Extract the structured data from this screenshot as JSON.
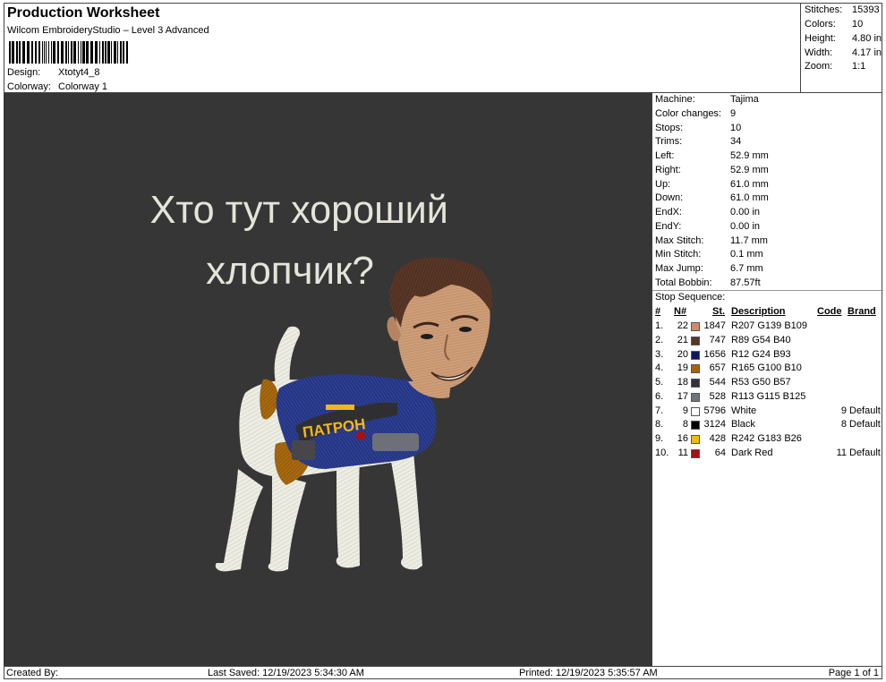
{
  "header": {
    "title": "Production Worksheet",
    "subtitle": "Wilcom EmbroideryStudio – Level 3 Advanced",
    "design_label": "Design:",
    "design_value": "Xtotyt4_8",
    "colorway_label": "Colorway:",
    "colorway_value": "Colorway 1"
  },
  "summary": {
    "stitches_label": "Stitches:",
    "stitches": "15393",
    "colors_label": "Colors:",
    "colors": "10",
    "height_label": "Height:",
    "height": "4.80 in",
    "width_label": "Width:",
    "width": "4.17 in",
    "zoom_label": "Zoom:",
    "zoom": "1:1"
  },
  "design_preview": {
    "caption_line1": "Хто тут хороший",
    "caption_line2": "хлопчик?",
    "vest_patch": "ПАТРОН"
  },
  "machine_info": [
    {
      "label": "Machine:",
      "value": "Tajima"
    },
    {
      "label": "Color changes:",
      "value": "9"
    },
    {
      "label": "Stops:",
      "value": "10"
    },
    {
      "label": "Trims:",
      "value": "34"
    },
    {
      "label": "Left:",
      "value": "52.9 mm"
    },
    {
      "label": "Right:",
      "value": "52.9 mm"
    },
    {
      "label": "Up:",
      "value": "61.0 mm"
    },
    {
      "label": "Down:",
      "value": "61.0 mm"
    },
    {
      "label": "EndX:",
      "value": "0.00 in"
    },
    {
      "label": "EndY:",
      "value": "0.00 in"
    },
    {
      "label": "Max Stitch:",
      "value": "11.7 mm"
    },
    {
      "label": "Min Stitch:",
      "value": "0.1 mm"
    },
    {
      "label": "Max Jump:",
      "value": "6.7 mm"
    },
    {
      "label": "Total Bobbin:",
      "value": "87.57ft"
    }
  ],
  "stop_sequence": {
    "title": "Stop Sequence:",
    "headers": {
      "idx": "#",
      "n": "N#",
      "st": "St.",
      "desc": "Description",
      "code": "Code",
      "brand": "Brand"
    },
    "rows": [
      {
        "idx": "1.",
        "n": "22",
        "color": "#CF8B6D",
        "st": "1847",
        "desc": "R207 G139 B109",
        "code": "",
        "brand": ""
      },
      {
        "idx": "2.",
        "n": "21",
        "color": "#593628",
        "st": "747",
        "desc": "R89 G54 B40",
        "code": "",
        "brand": ""
      },
      {
        "idx": "3.",
        "n": "20",
        "color": "#0C185D",
        "st": "1656",
        "desc": "R12 G24 B93",
        "code": "",
        "brand": ""
      },
      {
        "idx": "4.",
        "n": "19",
        "color": "#A5640A",
        "st": "657",
        "desc": "R165 G100 B10",
        "code": "",
        "brand": ""
      },
      {
        "idx": "5.",
        "n": "18",
        "color": "#353239",
        "st": "544",
        "desc": "R53 G50 B57",
        "code": "",
        "brand": ""
      },
      {
        "idx": "6.",
        "n": "17",
        "color": "#71737D",
        "st": "528",
        "desc": "R113 G115 B125",
        "code": "",
        "brand": ""
      },
      {
        "idx": "7.",
        "n": "9",
        "color": "#FFFFFF",
        "st": "5796",
        "desc": "White",
        "code": "9",
        "brand": "Default"
      },
      {
        "idx": "8.",
        "n": "8",
        "color": "#000000",
        "st": "3124",
        "desc": "Black",
        "code": "8",
        "brand": "Default"
      },
      {
        "idx": "9.",
        "n": "16",
        "color": "#F2B71A",
        "st": "428",
        "desc": "R242 G183 B26",
        "code": "",
        "brand": ""
      },
      {
        "idx": "10.",
        "n": "11",
        "color": "#A80F0F",
        "st": "64",
        "desc": "Dark Red",
        "code": "11",
        "brand": "Default"
      }
    ]
  },
  "footer": {
    "created_by": "Created By:",
    "last_saved": "Last Saved: 12/19/2023 5:34:30 AM",
    "printed": "Printed: 12/19/2023 5:35:57 AM",
    "page": "Page 1 of 1"
  },
  "colors": {
    "canvas_bg": "#363636",
    "thread_white": "#EDEDE3",
    "caption_text": "#E4E4DA"
  }
}
